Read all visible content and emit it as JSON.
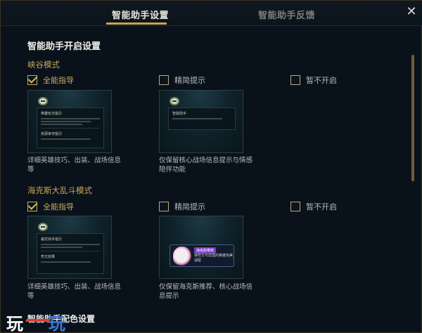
{
  "header": {
    "tabs": [
      {
        "label": "智能助手设置",
        "active": true
      },
      {
        "label": "智能助手反馈",
        "active": false
      }
    ],
    "close_icon": "close-icon",
    "close_symbol": "✕"
  },
  "settings": {
    "title": "智能助手开启设置",
    "modes": [
      {
        "title": "峡谷模式",
        "options": [
          {
            "label": "全能指导",
            "checked": true
          },
          {
            "label": "精简提示",
            "checked": false
          },
          {
            "label": "暂不开启",
            "checked": false
          }
        ],
        "previews": [
          {
            "panel_titles": [
              "英雄玩法指引",
              "资源争夺指引"
            ],
            "description": "详细英雄技巧、出装、战场信息等"
          },
          {
            "panel_titles": [
              "智能助手"
            ],
            "description": "仅保留核心战场信息提示与情感陪伴功能"
          }
        ]
      },
      {
        "title": "海克斯大乱斗模式",
        "options": [
          {
            "label": "全能指导",
            "checked": true
          },
          {
            "label": "精简提示",
            "checked": false
          },
          {
            "label": "暂不开启",
            "checked": false
          }
        ],
        "previews": [
          {
            "panel_titles": [
              "最优快手指引",
              "符文效果"
            ],
            "description": "详细英雄技巧、出装、战场信息等"
          },
          {
            "card_badge": "海克斯推荐",
            "card_text": "保符文与您选的英雄完美适配",
            "description": "仅保留海克斯推荐、核心战场信息提示"
          }
        ]
      }
    ],
    "next_section_title_partial": "智能助手配色设置"
  },
  "watermark": {
    "left": "玩",
    "right": "玩"
  },
  "colors": {
    "accent_gold": "#c8a552",
    "background": "#09121a",
    "checkbox_border": "#b9aa84"
  }
}
